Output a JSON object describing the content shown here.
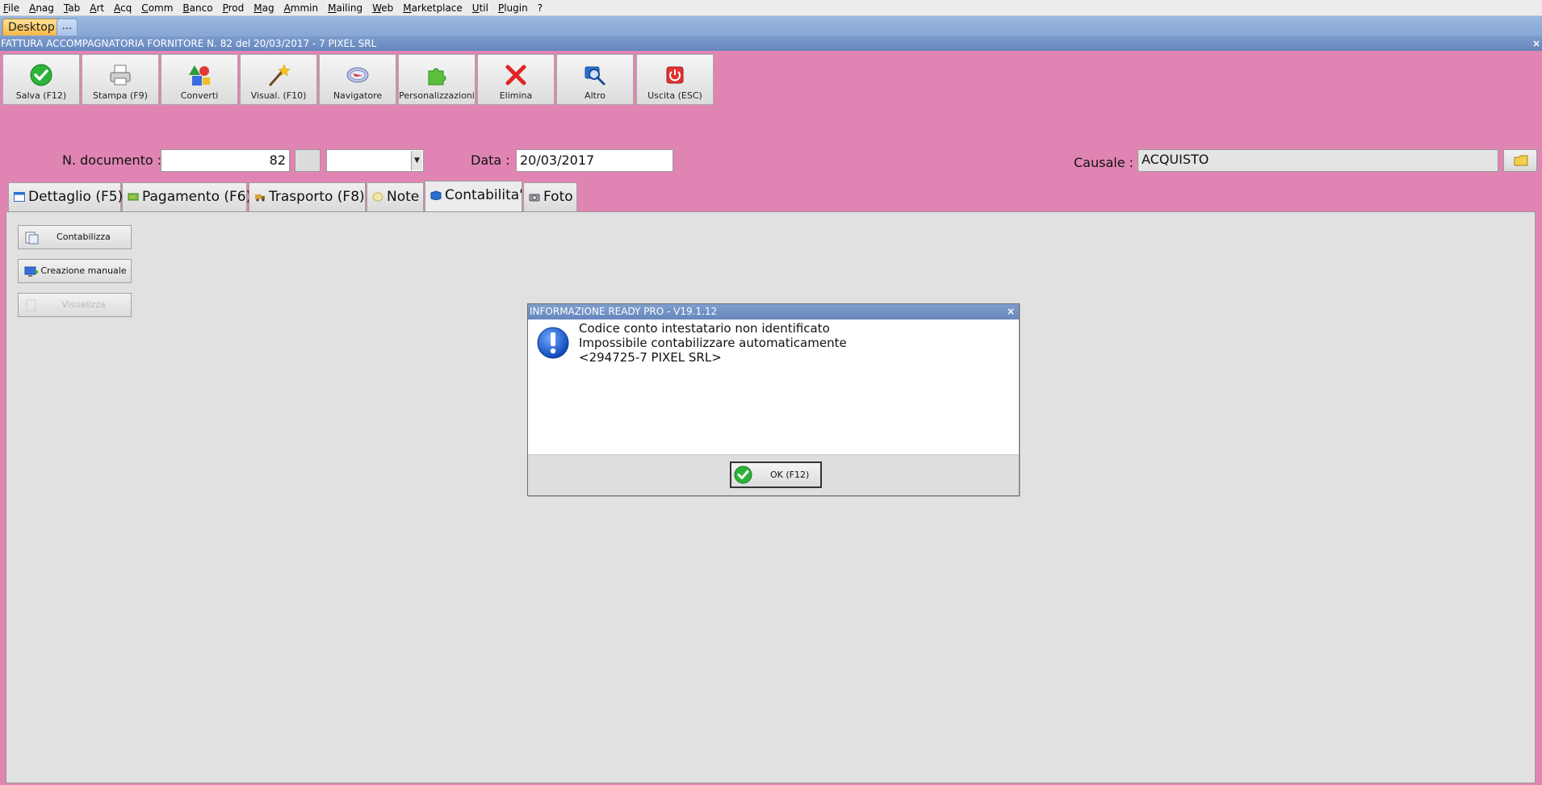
{
  "menu": [
    {
      "label": "File",
      "acc": "F",
      "rest": "ile"
    },
    {
      "label": "Anag",
      "acc": "A",
      "rest": "nag"
    },
    {
      "label": "Tab",
      "acc": "T",
      "rest": "ab"
    },
    {
      "label": "Art",
      "acc": "A",
      "rest": "rt"
    },
    {
      "label": "Acq",
      "acc": "A",
      "rest": "cq"
    },
    {
      "label": "Comm",
      "acc": "C",
      "rest": "omm"
    },
    {
      "label": "Banco",
      "acc": "B",
      "rest": "anco"
    },
    {
      "label": "Prod",
      "acc": "P",
      "rest": "rod"
    },
    {
      "label": "Mag",
      "acc": "M",
      "rest": "ag"
    },
    {
      "label": "Ammin",
      "acc": "A",
      "rest": "mmin"
    },
    {
      "label": "Mailing",
      "acc": "M",
      "rest": "ailing"
    },
    {
      "label": "Web",
      "acc": "W",
      "rest": "eb"
    },
    {
      "label": "Marketplace",
      "acc": "M",
      "rest": "arketplace"
    },
    {
      "label": "Util",
      "acc": "U",
      "rest": "til"
    },
    {
      "label": "Plugin",
      "acc": "P",
      "rest": "lugin"
    },
    {
      "label": "?",
      "acc": "",
      "rest": "?"
    }
  ],
  "desktop_tabs": {
    "desktop": "Desktop",
    "more": "..."
  },
  "window_title": "FATTURA ACCOMPAGNATORIA FORNITORE N. 82 del 20/03/2017 - 7 PIXEL SRL",
  "window_close": "×",
  "toolbar": {
    "save": "Salva (F12)",
    "print": "Stampa (F9)",
    "convert": "Converti",
    "view": "Visual. (F10)",
    "navigator": "Navigatore",
    "customize": "Personalizzazioni",
    "delete": "Elimina",
    "other": "Altro",
    "exit": "Uscita (ESC)"
  },
  "header": {
    "ndoc_label": "N. documento :",
    "ndoc_value": "82",
    "data_label": "Data :",
    "data_value": "20/03/2017",
    "causale_label": "Causale :",
    "causale_value": "ACQUISTO"
  },
  "tabs": {
    "detail": "Dettaglio (F5)",
    "payment": "Pagamento (F6)",
    "transport": "Trasporto (F8)",
    "notes": "Note",
    "accounting": "Contabilita'",
    "photo": "Foto"
  },
  "side_buttons": {
    "post": "Contabilizza",
    "manual": "Creazione manuale",
    "view": "Visualizza"
  },
  "dialog": {
    "title": "INFORMAZIONE READY PRO - V19.1.12",
    "close": "×",
    "line1": "Codice conto intestatario non identificato",
    "line2": "Impossibile contabilizzare automaticamente",
    "line3": "<294725-7 PIXEL SRL>",
    "ok": "OK (F12)"
  },
  "colors": {
    "background": "#e085b3",
    "titlebar": "#6f8fc5",
    "panel": "#e1e1e1"
  }
}
